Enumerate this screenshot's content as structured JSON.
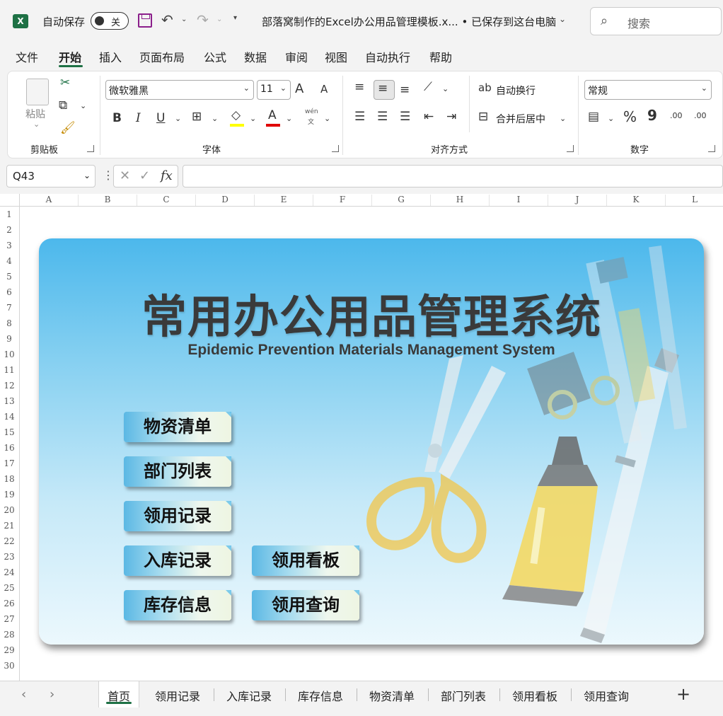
{
  "titlebar": {
    "app_icon": "excel-icon",
    "autosave_label": "自动保存",
    "autosave_state": "关",
    "doc_title": "部落窝制作的Excel办公用品管理模板.x... • 已保存到这台电脑",
    "search_placeholder": "搜索"
  },
  "menu": {
    "items": [
      "文件",
      "开始",
      "插入",
      "页面布局",
      "公式",
      "数据",
      "审阅",
      "视图",
      "自动执行",
      "帮助"
    ],
    "active": "开始"
  },
  "ribbon": {
    "clipboard": {
      "paste_label": "粘贴",
      "group_label": "剪贴板"
    },
    "font": {
      "font_name": "微软雅黑",
      "font_size": "11",
      "group_label": "字体",
      "bold": "B",
      "italic": "I",
      "underline": "U",
      "increase": "A",
      "decrease": "A",
      "font_color_glyph": "A",
      "pinyin": "wén",
      "pinyin_sub": "文"
    },
    "alignment": {
      "wrap_label": "自动换行",
      "merge_label": "合并后居中",
      "group_label": "对齐方式"
    },
    "number": {
      "format": "常规",
      "group_label": "数字",
      "percent": "%",
      "comma": "9",
      "inc_decimal": ".00",
      "dec_decimal": ".00"
    }
  },
  "formula_bar": {
    "name_box": "Q43",
    "fx": "fx",
    "value": ""
  },
  "columns": [
    "A",
    "B",
    "C",
    "D",
    "E",
    "F",
    "G",
    "H",
    "I",
    "J",
    "K",
    "L"
  ],
  "rows": [
    "1",
    "2",
    "3",
    "4",
    "5",
    "6",
    "7",
    "8",
    "9",
    "10",
    "11",
    "12",
    "13",
    "14",
    "15",
    "16",
    "17",
    "18",
    "19",
    "20",
    "21",
    "22",
    "23",
    "24",
    "25",
    "26",
    "27",
    "28",
    "29",
    "30"
  ],
  "banner": {
    "title": "常用办公用品管理系统",
    "subtitle": "Epidemic Prevention Materials Management System",
    "buttons": {
      "materials": "物资清单",
      "departments": "部门列表",
      "usage_records": "领用记录",
      "inbound_records": "入库记录",
      "usage_board": "领用看板",
      "inventory": "库存信息",
      "usage_query": "领用查询"
    },
    "colors": {
      "gradient_top": "#4cb8ec",
      "gradient_bottom": "#ecf8fd",
      "title": "#3a3a3a"
    }
  },
  "sheet_tabs": {
    "tabs": [
      "首页",
      "领用记录",
      "入库记录",
      "库存信息",
      "物资清单",
      "部门列表",
      "领用看板",
      "领用查询"
    ],
    "active": "首页",
    "add": "+"
  },
  "accent_color": "#1e7145"
}
